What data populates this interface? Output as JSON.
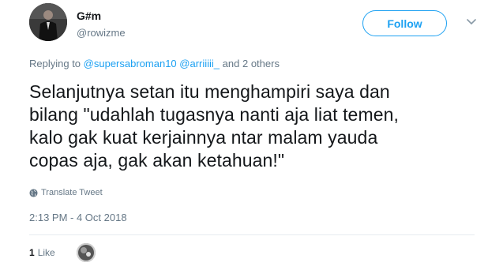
{
  "user": {
    "display_name": "G#m",
    "handle": "@rowizme"
  },
  "follow_button": {
    "label": "Follow"
  },
  "reply": {
    "prefix": "Replying to",
    "mention_1": "@supersabroman10",
    "mention_2": "@arriiiii_",
    "suffix": "and 2 others"
  },
  "tweet": {
    "line_1": "Selanjutnya setan itu menghampiri saya dan",
    "line_2": "bilang \"udahlah tugasnya nanti aja liat temen,",
    "line_3": "kalo gak kuat kerjainnya ntar malam yauda",
    "line_4": "copas aja, gak akan ketahuan!\""
  },
  "translate": {
    "label": "Translate Tweet",
    "icon": "globe-icon"
  },
  "timestamp": "2:13 PM - 4 Oct 2018",
  "likes": {
    "count": "1",
    "label": "Like"
  },
  "colors": {
    "accent": "#1da1f2",
    "secondary_text": "#657786",
    "primary_text": "#14171a",
    "divider": "#e6ecf0"
  },
  "icons": {
    "more": "chevron-down-icon",
    "avatar": "avatar",
    "liker": "liker-avatar"
  }
}
